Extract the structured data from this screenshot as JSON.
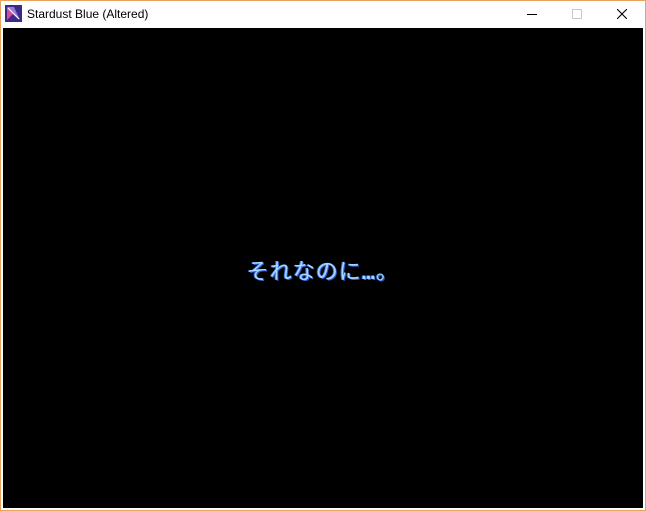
{
  "window": {
    "title": "Stardust Blue (Altered)",
    "icon": "app-sword-icon",
    "controls": {
      "minimize": "minimize-icon",
      "maximize": "maximize-icon",
      "close": "close-icon"
    },
    "border_color": "#e8a25a"
  },
  "game": {
    "background": "#000000",
    "dialogue_text": "それなのに…。",
    "text_color": "#a8d4ff"
  }
}
